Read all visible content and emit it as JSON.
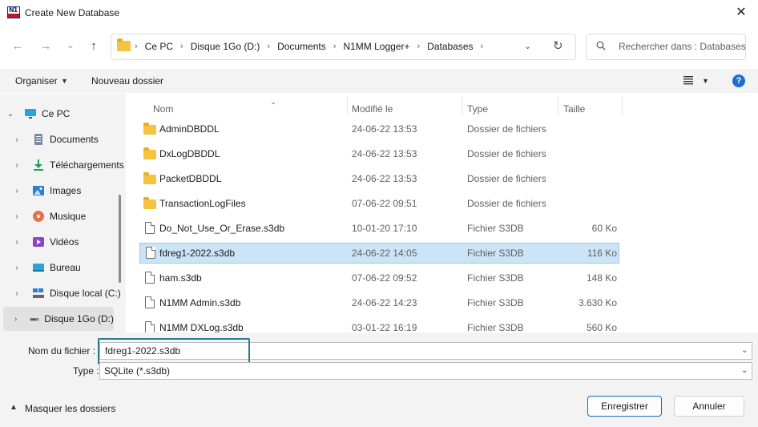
{
  "window": {
    "title": "Create New Database",
    "close": "✕",
    "app_icon_text": "N1"
  },
  "nav": {
    "back": "←",
    "forward": "→",
    "recent": "⌄",
    "up": "↑",
    "breadcrumb": [
      "Ce PC",
      "Disque 1Go (D:)",
      "Documents",
      "N1MM Logger+",
      "Databases"
    ],
    "dropdown": "⌄",
    "refresh": "↻"
  },
  "search": {
    "placeholder": "Rechercher dans : Databases"
  },
  "toolbar": {
    "organiser": "Organiser",
    "new_folder": "Nouveau dossier",
    "help": "?"
  },
  "sidebar": {
    "items": [
      {
        "label": "Ce PC",
        "icon": "monitor-icon",
        "chevron": "⌄"
      },
      {
        "label": "Documents",
        "icon": "documents-icon",
        "chevron": "›"
      },
      {
        "label": "Téléchargements",
        "icon": "download-icon",
        "chevron": "›"
      },
      {
        "label": "Images",
        "icon": "image-icon",
        "chevron": "›"
      },
      {
        "label": "Musique",
        "icon": "music-icon",
        "chevron": "›"
      },
      {
        "label": "Vidéos",
        "icon": "video-icon",
        "chevron": "›"
      },
      {
        "label": "Bureau",
        "icon": "desktop-icon",
        "chevron": "›"
      },
      {
        "label": "Disque local (C:)",
        "icon": "drive-icon",
        "chevron": "›"
      },
      {
        "label": "Disque 1Go (D:)",
        "icon": "drive-icon",
        "chevron": "›"
      }
    ],
    "selected_index": 8
  },
  "columns": {
    "name": "Nom",
    "modified": "Modifié le",
    "type": "Type",
    "size": "Taille"
  },
  "files": [
    {
      "name": "AdminDBDDL",
      "modified": "24-06-22 13:53",
      "type": "Dossier de fichiers",
      "size": "",
      "kind": "folder"
    },
    {
      "name": "DxLogDBDDL",
      "modified": "24-06-22 13:53",
      "type": "Dossier de fichiers",
      "size": "",
      "kind": "folder"
    },
    {
      "name": "PacketDBDDL",
      "modified": "24-06-22 13:53",
      "type": "Dossier de fichiers",
      "size": "",
      "kind": "folder"
    },
    {
      "name": "TransactionLogFiles",
      "modified": "07-06-22 09:51",
      "type": "Dossier de fichiers",
      "size": "",
      "kind": "folder"
    },
    {
      "name": "Do_Not_Use_Or_Erase.s3db",
      "modified": "10-01-20 17:10",
      "type": "Fichier S3DB",
      "size": "60 Ko",
      "kind": "file"
    },
    {
      "name": "fdreg1-2022.s3db",
      "modified": "24-06-22 14:05",
      "type": "Fichier S3DB",
      "size": "116 Ko",
      "kind": "file"
    },
    {
      "name": "ham.s3db",
      "modified": "07-06-22 09:52",
      "type": "Fichier S3DB",
      "size": "148 Ko",
      "kind": "file"
    },
    {
      "name": "N1MM Admin.s3db",
      "modified": "24-06-22 14:23",
      "type": "Fichier S3DB",
      "size": "3.630 Ko",
      "kind": "file"
    },
    {
      "name": "N1MM DXLog.s3db",
      "modified": "03-01-22 16:19",
      "type": "Fichier S3DB",
      "size": "560 Ko",
      "kind": "file"
    }
  ],
  "selected_file_index": 5,
  "form": {
    "filename_label": "Nom du fichier :",
    "filename_value": "fdreg1-2022.s3db",
    "type_label": "Type :",
    "type_value": "SQLite (*.s3db)"
  },
  "footer": {
    "hide_folders": "Masquer les dossiers",
    "save": "Enregistrer",
    "cancel": "Annuler"
  }
}
